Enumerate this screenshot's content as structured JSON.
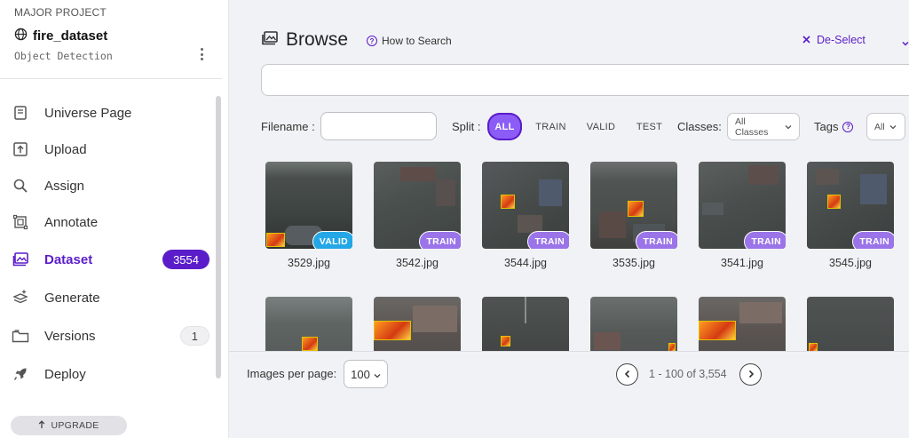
{
  "project": {
    "label": "MAJOR PROJECT",
    "name": "fire_dataset",
    "type": "Object Detection"
  },
  "sidebar": {
    "items": [
      {
        "label": "Universe Page",
        "icon": "book-icon"
      },
      {
        "label": "Upload",
        "icon": "upload-icon"
      },
      {
        "label": "Assign",
        "icon": "search-icon"
      },
      {
        "label": "Annotate",
        "icon": "annotate-icon"
      },
      {
        "label": "Dataset",
        "icon": "images-icon",
        "badge": "3554",
        "active": true
      },
      {
        "label": "Generate",
        "icon": "layers-icon"
      },
      {
        "label": "Versions",
        "icon": "folder-icon",
        "badge": "1"
      },
      {
        "label": "Deploy",
        "icon": "rocket-icon"
      }
    ],
    "upgrade_label": "UPGRADE"
  },
  "header": {
    "title": "Browse",
    "how_to_search": "How to Search",
    "deselect": "De-Select"
  },
  "search": {
    "placeholder": ""
  },
  "filters": {
    "filename_label": "Filename :",
    "split_label": "Split :",
    "split_options": [
      "ALL",
      "TRAIN",
      "VALID",
      "TEST"
    ],
    "split_selected": "ALL",
    "classes_label": "Classes:",
    "classes_value": "All Classes",
    "tags_label": "Tags",
    "tags_value": "All"
  },
  "images": [
    {
      "filename": "3529.jpg",
      "split": "VALID"
    },
    {
      "filename": "3542.jpg",
      "split": "TRAIN"
    },
    {
      "filename": "3544.jpg",
      "split": "TRAIN"
    },
    {
      "filename": "3535.jpg",
      "split": "TRAIN"
    },
    {
      "filename": "3541.jpg",
      "split": "TRAIN"
    },
    {
      "filename": "3545.jpg",
      "split": "TRAIN"
    }
  ],
  "pagination": {
    "per_page_label": "Images per page:",
    "per_page_value": "100",
    "range_text": "1 - 100 of 3,554"
  },
  "colors": {
    "accent": "#5b1dc9",
    "train_tag": "#9a74e8",
    "valid_tag": "#23a7e6"
  }
}
